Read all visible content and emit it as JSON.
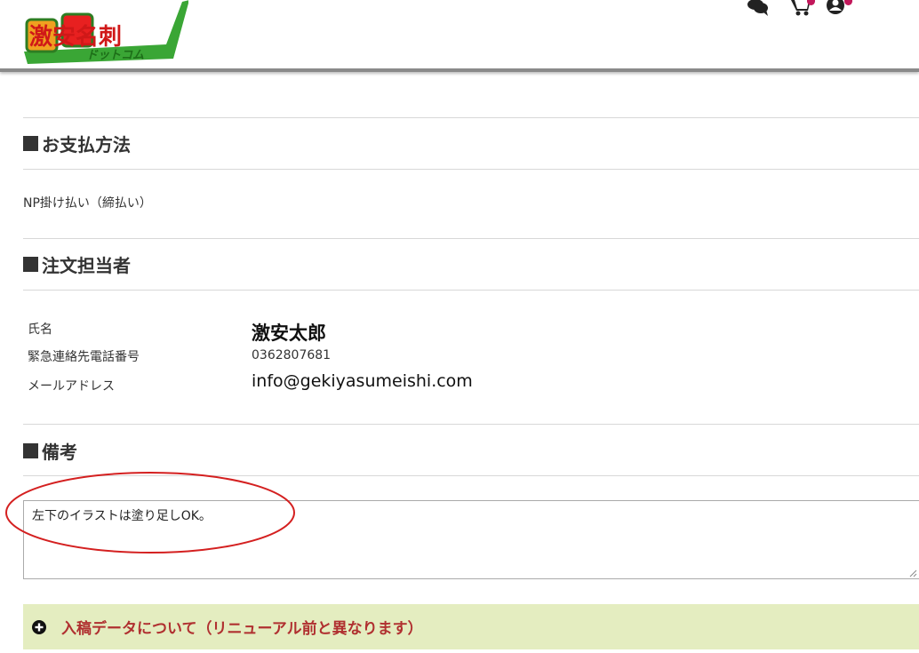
{
  "header": {
    "logo_text": "激安名刺",
    "logo_subtext": "ドットコム",
    "icons": [
      "chat-icon",
      "cart-icon",
      "account-icon"
    ]
  },
  "payment": {
    "title": "お支払方法",
    "method": "NP掛け払い（締払い）"
  },
  "orderer": {
    "title": "注文担当者",
    "rows": [
      {
        "label": "氏名",
        "value": "激安太郎"
      },
      {
        "label": "緊急連絡先電話番号",
        "value": "0362807681"
      },
      {
        "label": "メールアドレス",
        "value": "info@gekiyasumeishi.com"
      }
    ]
  },
  "remarks": {
    "title": "備考",
    "text": "左下のイラストは塗り足しOK。"
  },
  "accordion": {
    "label": "入稿データについて（リニューアル前と異なります）"
  },
  "colors": {
    "accent_red": "#b03030",
    "accordion_bg": "#e4edc0",
    "annotation_red": "#d42020"
  }
}
